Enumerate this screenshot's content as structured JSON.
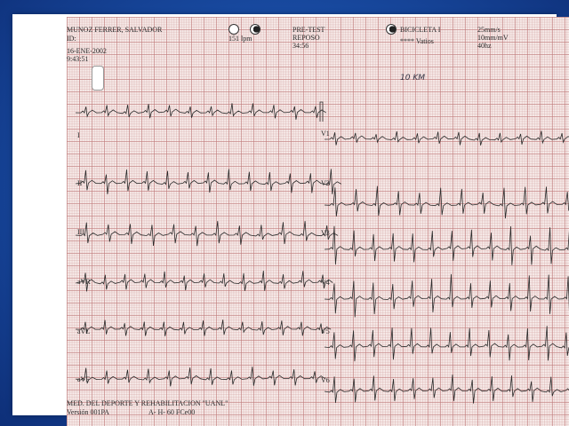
{
  "header": {
    "patient_name": "MUNOZ FERRER, SALVADOR",
    "id_label": "ID:",
    "date": "16-ENE-2002",
    "time": "9:43:51",
    "heart_rate": "151 lpm",
    "test_phase": "PRE-TEST",
    "test_state": "REPOSO",
    "elapsed": "34:56",
    "device": "BICICLETA I",
    "watts": "**** Vatios",
    "paper_speed": "25mm/s",
    "gain": "10mm/mV",
    "filter": "40hz"
  },
  "handwritten_note": "10 KM",
  "leads": {
    "left": [
      "I",
      "II",
      "III",
      "aVR",
      "aVL",
      "aVF"
    ],
    "right": [
      "V1",
      "V2",
      "V3",
      "V4",
      "V5",
      "V6"
    ]
  },
  "footer": {
    "institution": "MED. DEL DEPORTE Y REHABILITACION \"UANL\"",
    "version": "Versión 001PA",
    "settings": "A- H- 60 FCe00"
  },
  "colors": {
    "background": "#1a4fa8",
    "paper": "#f7ecea",
    "grid": "#be7878",
    "trace": "#2b2b2b"
  }
}
